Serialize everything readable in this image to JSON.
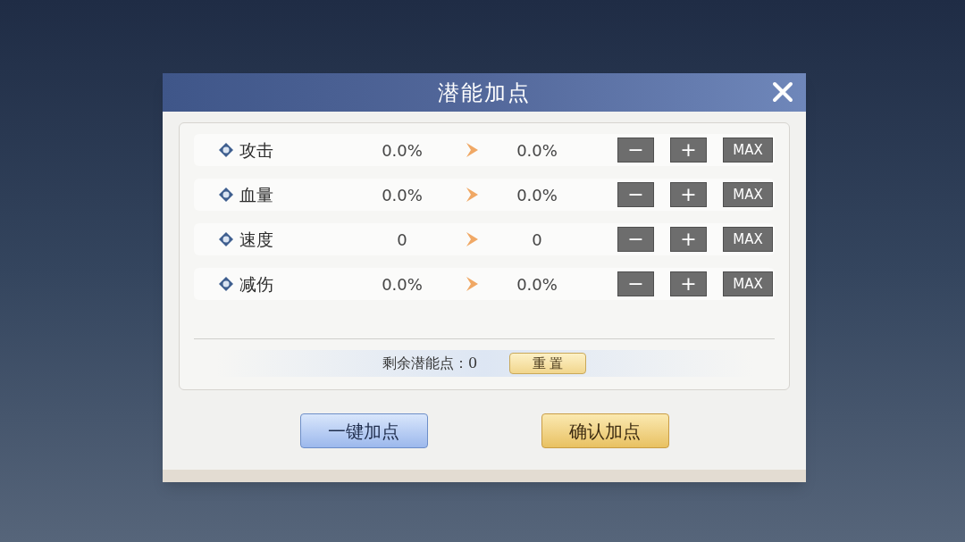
{
  "dialog": {
    "title": "潜能加点",
    "attributes": [
      {
        "label": "攻击",
        "current": "0.0%",
        "next": "0.0%",
        "buttons": [
          "−",
          "+",
          "MAX"
        ]
      },
      {
        "label": "血量",
        "current": "0.0%",
        "next": "0.0%",
        "buttons": [
          "−",
          "+",
          "MAX"
        ]
      },
      {
        "label": "速度",
        "current": "0",
        "next": "0",
        "buttons": [
          "−",
          "+",
          "MAX"
        ]
      },
      {
        "label": "减伤",
        "current": "0.0%",
        "next": "0.0%",
        "buttons": [
          "−",
          "+",
          "MAX"
        ]
      }
    ],
    "remaining": {
      "label": "剩余潜能点：",
      "value": "0"
    },
    "reset_button": "重 置",
    "actions": [
      {
        "label": "一键加点",
        "kind": "secondary"
      },
      {
        "label": "确认加点",
        "kind": "primary"
      }
    ]
  }
}
